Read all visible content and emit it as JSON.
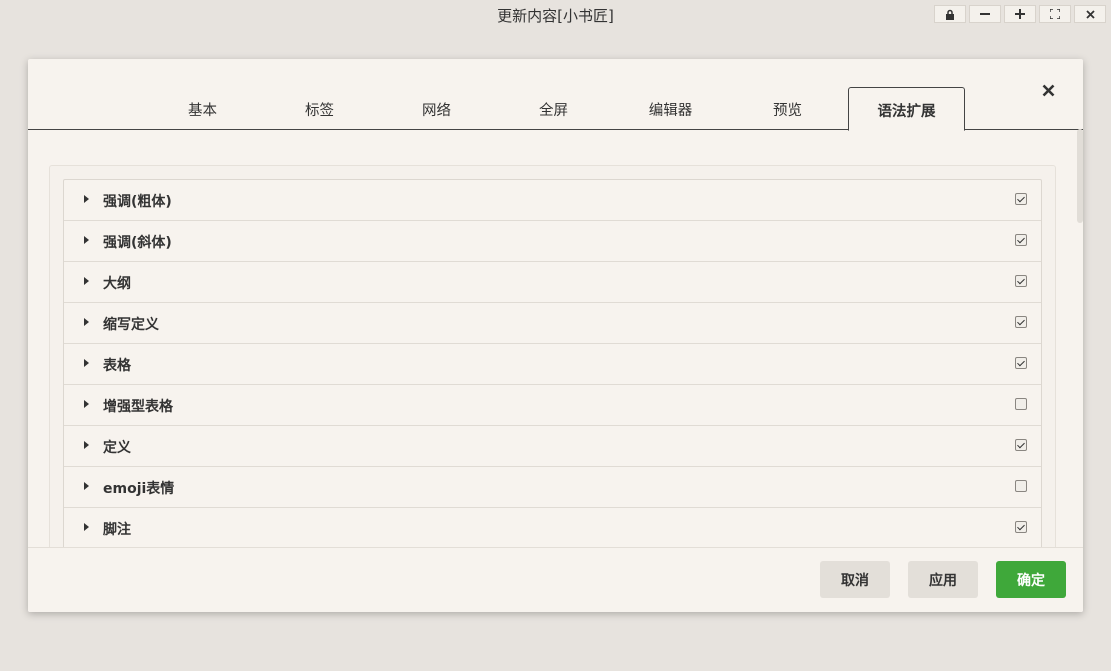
{
  "window": {
    "title": "更新内容[小书匠]",
    "controls": [
      {
        "name": "lock-icon"
      },
      {
        "name": "minimize-icon"
      },
      {
        "name": "plus-icon"
      },
      {
        "name": "fullscreen-icon"
      },
      {
        "name": "close-icon"
      }
    ]
  },
  "dialog": {
    "close_glyph": "✕",
    "tabs": [
      {
        "label": "基本",
        "active": false
      },
      {
        "label": "标签",
        "active": false
      },
      {
        "label": "网络",
        "active": false
      },
      {
        "label": "全屏",
        "active": false
      },
      {
        "label": "编辑器",
        "active": false
      },
      {
        "label": "预览",
        "active": false
      },
      {
        "label": "语法扩展",
        "active": true
      }
    ],
    "extensions": [
      {
        "label": "强调(粗体)",
        "checked": true
      },
      {
        "label": "强调(斜体)",
        "checked": true
      },
      {
        "label": "大纲",
        "checked": true
      },
      {
        "label": "缩写定义",
        "checked": true
      },
      {
        "label": "表格",
        "checked": true
      },
      {
        "label": "增强型表格",
        "checked": false
      },
      {
        "label": "定义",
        "checked": true
      },
      {
        "label": "emoji表情",
        "checked": false
      },
      {
        "label": "脚注",
        "checked": true
      }
    ],
    "buttons": {
      "cancel": "取消",
      "apply": "应用",
      "ok": "确定"
    }
  },
  "colors": {
    "primary": "#3fa83a",
    "background": "#e7e3de",
    "dialog": "#f7f3ee"
  }
}
